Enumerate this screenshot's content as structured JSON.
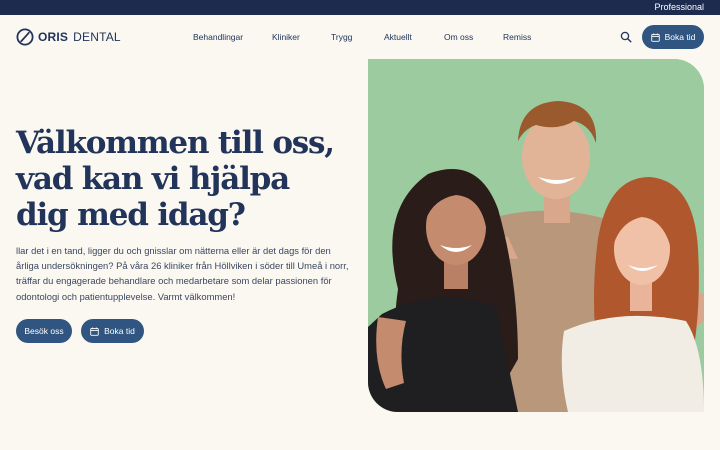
{
  "topbar": {
    "professional_label": "Professional"
  },
  "header": {
    "logo": {
      "brand": "ORIS",
      "sub": "DENTAL"
    },
    "nav": [
      {
        "label": "Behandlingar"
      },
      {
        "label": "Kliniker"
      },
      {
        "label": "Trygg"
      },
      {
        "label": "Aktuellt"
      },
      {
        "label": "Om oss"
      },
      {
        "label": "Remiss"
      }
    ],
    "search_icon": "search-icon",
    "book_label": "Boka tid"
  },
  "hero": {
    "headline": [
      "Välkommen till oss,",
      "vad kan vi hjälpa",
      "dig med idag?"
    ],
    "intro": "llar det i en tand, ligger du och gnisslar om nätterna eller är det dags för den årliga undersökningen? På våra 26 kliniker från Höllviken i söder till Umeå i norr, träffar du engagerade behandlare och medarbetare som delar passionen för odontologi och patientupplevelse. Varmt välkommen!",
    "visit_label": "Besök oss",
    "book_label": "Boka tid",
    "image_subject": "three smiling young people on green background"
  },
  "colors": {
    "topbar": "#1c2b4e",
    "primary": "#2f5580",
    "text": "#22345a",
    "background": "#fbf8f2",
    "image_background": "#9ccb9f"
  }
}
